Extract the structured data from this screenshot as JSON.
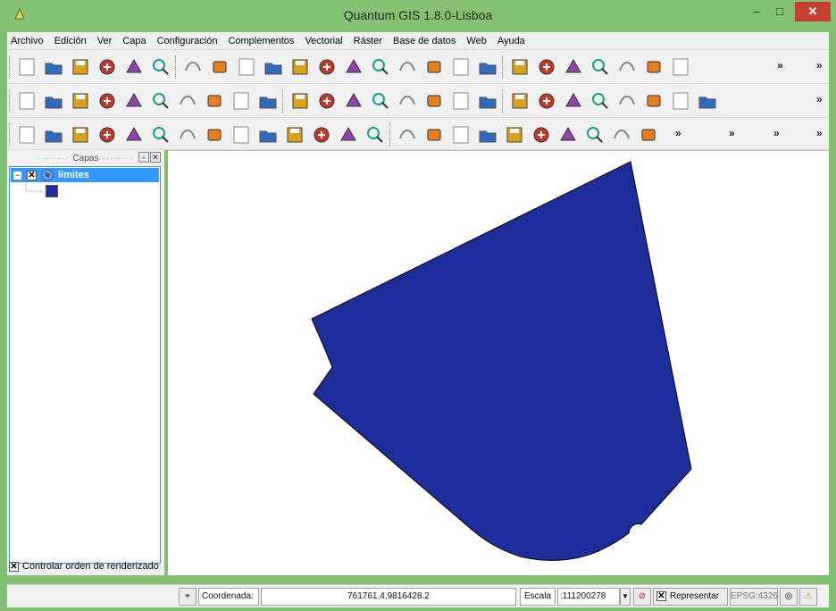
{
  "window": {
    "title": "Quantum GIS 1.8.0-Lisboa",
    "minimize": "–",
    "maximize": "□",
    "close": "✕"
  },
  "menu": [
    "Archivo",
    "Edición",
    "Ver",
    "Capa",
    "Configuración",
    "Complementos",
    "Vectorial",
    "Ráster",
    "Base de datos",
    "Web",
    "Ayuda"
  ],
  "toolbars": {
    "more": "»",
    "row1": [
      "new-project-icon",
      "open-project-icon",
      "save-project-icon",
      "save-as-icon",
      "print-composer-icon",
      "print-icon",
      "add-vector-layer-icon",
      "add-raster-layer-icon",
      "add-postgis-layer-icon",
      "add-spatialite-layer-icon",
      "add-mssql-layer-icon",
      "add-wms-layer-icon",
      "add-wfs-layer-icon",
      "new-shapefile-icon",
      "remove-layer-icon",
      "add-delimited-text-icon",
      "add-gpx-icon",
      "oracle-layer-icon",
      "toggle-editing-icon",
      "save-edits-icon",
      "add-feature-icon",
      "move-feature-icon",
      "node-tool-icon",
      "delete-selected-icon",
      "digitize-icon"
    ],
    "row2": [
      "layer-visibility-icon",
      "favorites-icon",
      "remove-all-icon",
      "show-all-icon",
      "add-to-overview-icon",
      "map-tips-icon",
      "measure-icon",
      "identify-icon",
      "annotation-icon",
      "text-annotation-icon",
      "label-icon",
      "pin-label-icon",
      "rotate-label-icon",
      "change-label-icon",
      "osm-icon",
      "raster-tools-icon",
      "globe-icon",
      "histogram-icon",
      "pan-icon",
      "pan-to-selection-icon",
      "zoom-in-icon",
      "zoom-out-icon",
      "zoom-full-icon",
      "zoom-layer-icon",
      "zoom-selection-icon",
      "zoom-last-icon"
    ],
    "row3": [
      "undo-icon",
      "redo-icon",
      "simplify-icon",
      "add-ring-icon",
      "add-part-icon",
      "fill-ring-icon",
      "delete-ring-icon",
      "delete-part-icon",
      "reshape-icon",
      "offset-curve-icon",
      "split-icon",
      "split-parts-icon",
      "merge-icon",
      "rotate-icon",
      "identify-features-icon",
      "action-icon",
      "select-icon",
      "deselect-icon",
      "attribute-table-icon",
      "measure-line-icon",
      "tooltip-icon",
      "diagram-icon",
      "georeferencer-icon",
      "python-icon"
    ]
  },
  "layers_panel": {
    "title": "Capas",
    "layer_name": "limites",
    "layer_color": "#1f2d9a",
    "render_order_label": "Controlar orden de renderizado"
  },
  "map": {
    "fill_color": "#1f2d9a",
    "stroke_color": "#000000"
  },
  "statusbar": {
    "coord_label": "Coordenada:",
    "coord_value": "761761.4,9816428.2",
    "scale_label": "Escala",
    "scale_value": ":111200278",
    "render_label": "Representar",
    "crs": "EPSG:4326"
  }
}
